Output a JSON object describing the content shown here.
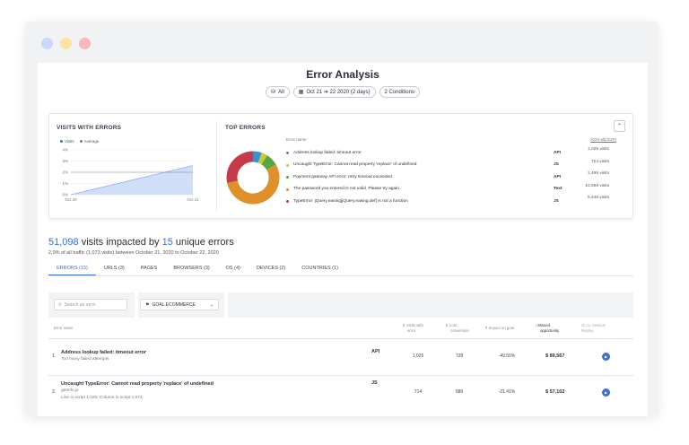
{
  "window": {
    "colors": {
      "accent": "#3b6fd7"
    }
  },
  "page": {
    "title": "Error Analysis",
    "filters": [
      {
        "icon": "segment-icon",
        "label": "All"
      },
      {
        "icon": "calendar-icon",
        "label": "Oct 21 ➔ 22 2020 (2 days)"
      },
      {
        "icon": "",
        "label": "2 Conditions"
      }
    ]
  },
  "visits_chart": {
    "title": "VISITS WITH ERRORS",
    "chart_data": {
      "type": "area",
      "x": [
        "Oct 20",
        "Oct 21"
      ],
      "series": [
        {
          "name": "Visits",
          "values": [
            0,
            2.6
          ],
          "color": "#8fb0f0"
        },
        {
          "name": "Average",
          "values": [
            2.0,
            2.0
          ],
          "color": "#7a7f8a"
        }
      ],
      "yticks": [
        "0%",
        "1%",
        "2%",
        "3%",
        "4%"
      ],
      "ylim": [
        0,
        4
      ],
      "xlabel": "",
      "ylabel": "",
      "legend": "top-left",
      "grid": true
    }
  },
  "top_errors": {
    "title": "TOP ERRORS",
    "col_name": "Error name",
    "col_right": "2020-all(2020)",
    "chart_data": {
      "type": "pie",
      "categories": [
        "Address lookup failed: timeout error",
        "Uncaught TypeError: Cannot read property 'replace' of undefined",
        "Payment gateway API error: retry timeout exceeded",
        "The password you entered is not valid. Please try again.",
        "TypeError: jQuery.easing[jQuery.easing.def] is not a function"
      ],
      "values": [
        1025,
        714,
        1495,
        10598,
        5446
      ],
      "colors": [
        "#3a8fd1",
        "#c8c838",
        "#56a83f",
        "#e0902a",
        "#c63a4a"
      ]
    },
    "items": [
      {
        "name": "Address lookup failed: timeout error",
        "type": "API",
        "visits": "1,025 visits",
        "color": "#3a8fd1"
      },
      {
        "name": "Uncaught TypeError: Cannot read property 'replace' of undefined",
        "type": "JS",
        "visits": "714 visits",
        "color": "#c8c838"
      },
      {
        "name": "Payment gateway API error: retry timeout exceeded",
        "type": "API",
        "visits": "1,495 visits",
        "color": "#56a83f"
      },
      {
        "name": "The password you entered is not valid. Please try again.",
        "type": "Text",
        "visits": "10,598 visits",
        "color": "#e0902a"
      },
      {
        "name": "TypeError: jQuery.easing[jQuery.easing.def] is not a function",
        "type": "JS",
        "visits": "5,446 visits",
        "color": "#c63a4a"
      }
    ]
  },
  "summary": {
    "visits": "51,098",
    "mid": " visits impacted by ",
    "errors": "15",
    "end": " unique errors",
    "sub": "2.0% of all traffic (1,073 visits) between October 21, 2020 to October 22, 2020"
  },
  "tabs": [
    {
      "label": "ERRORS (15)",
      "active": true
    },
    {
      "label": "URLS (3)"
    },
    {
      "label": "PAGES"
    },
    {
      "label": "BROWSERS (3)"
    },
    {
      "label": "OS (4)"
    },
    {
      "label": "DEVICES (2)"
    },
    {
      "label": "COUNTRIES (1)"
    }
  ],
  "toolbar": {
    "search_placeholder": "Search an error",
    "goal_label": "GOAL.ECOMMERCE"
  },
  "table": {
    "headers": {
      "name": "Error name",
      "visits_a": "Visits with",
      "visits_b": "error",
      "lost_a": "Lost",
      "lost_b": "conversion",
      "impact": "Impact on goal",
      "opp_a": "Missed",
      "opp_b": "opportunity",
      "replay_a": "Go to Session",
      "replay_b": "Replay"
    },
    "rows": [
      {
        "num": "1.",
        "title": "Address lookup failed: timeout error",
        "sub": "Too many failed attempts",
        "sub2": "",
        "type": "API",
        "visits": "1,025",
        "lost": "728",
        "impact": "-49.55%",
        "opportunity": "$ 89,567"
      },
      {
        "num": "2.",
        "title": "Uncaught TypeError: Cannot read property 'replace' of undefined",
        "sub": "getInfo.js",
        "sub2": "Line in script 1,020, Column in script 1,074",
        "type": "JS",
        "visits": "714",
        "lost": "589",
        "impact": "-21.41%",
        "opportunity": "$ 57,102"
      }
    ]
  }
}
